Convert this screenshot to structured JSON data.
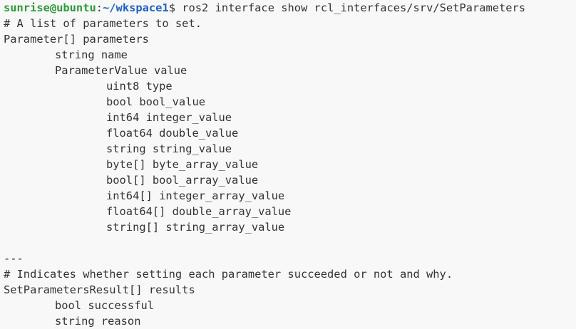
{
  "prompt": {
    "user_host": "sunrise@ubuntu",
    "separator": ":",
    "path": "~/wkspace1",
    "sigil": "$",
    "command": " ros2 interface show rcl_interfaces/srv/SetParameters"
  },
  "request": {
    "comment": "# A list of parameters to set.",
    "field_line": "Parameter[] parameters",
    "parameter_fields": [
      "string name",
      "ParameterValue value"
    ],
    "value_fields": [
      "uint8 type",
      "bool bool_value",
      "int64 integer_value",
      "float64 double_value",
      "string string_value",
      "byte[] byte_array_value",
      "bool[] bool_array_value",
      "int64[] integer_array_value",
      "float64[] double_array_value",
      "string[] string_array_value"
    ]
  },
  "separator_line": "---",
  "response": {
    "comment": "# Indicates whether setting each parameter succeeded or not and why.",
    "field_line": "SetParametersResult[] results",
    "result_fields": [
      "bool successful",
      "string reason"
    ]
  },
  "colors": {
    "background": "#f8f8f8",
    "text": "#333333",
    "prompt_user": "#2e9a3a",
    "prompt_path": "#1f62c4"
  }
}
